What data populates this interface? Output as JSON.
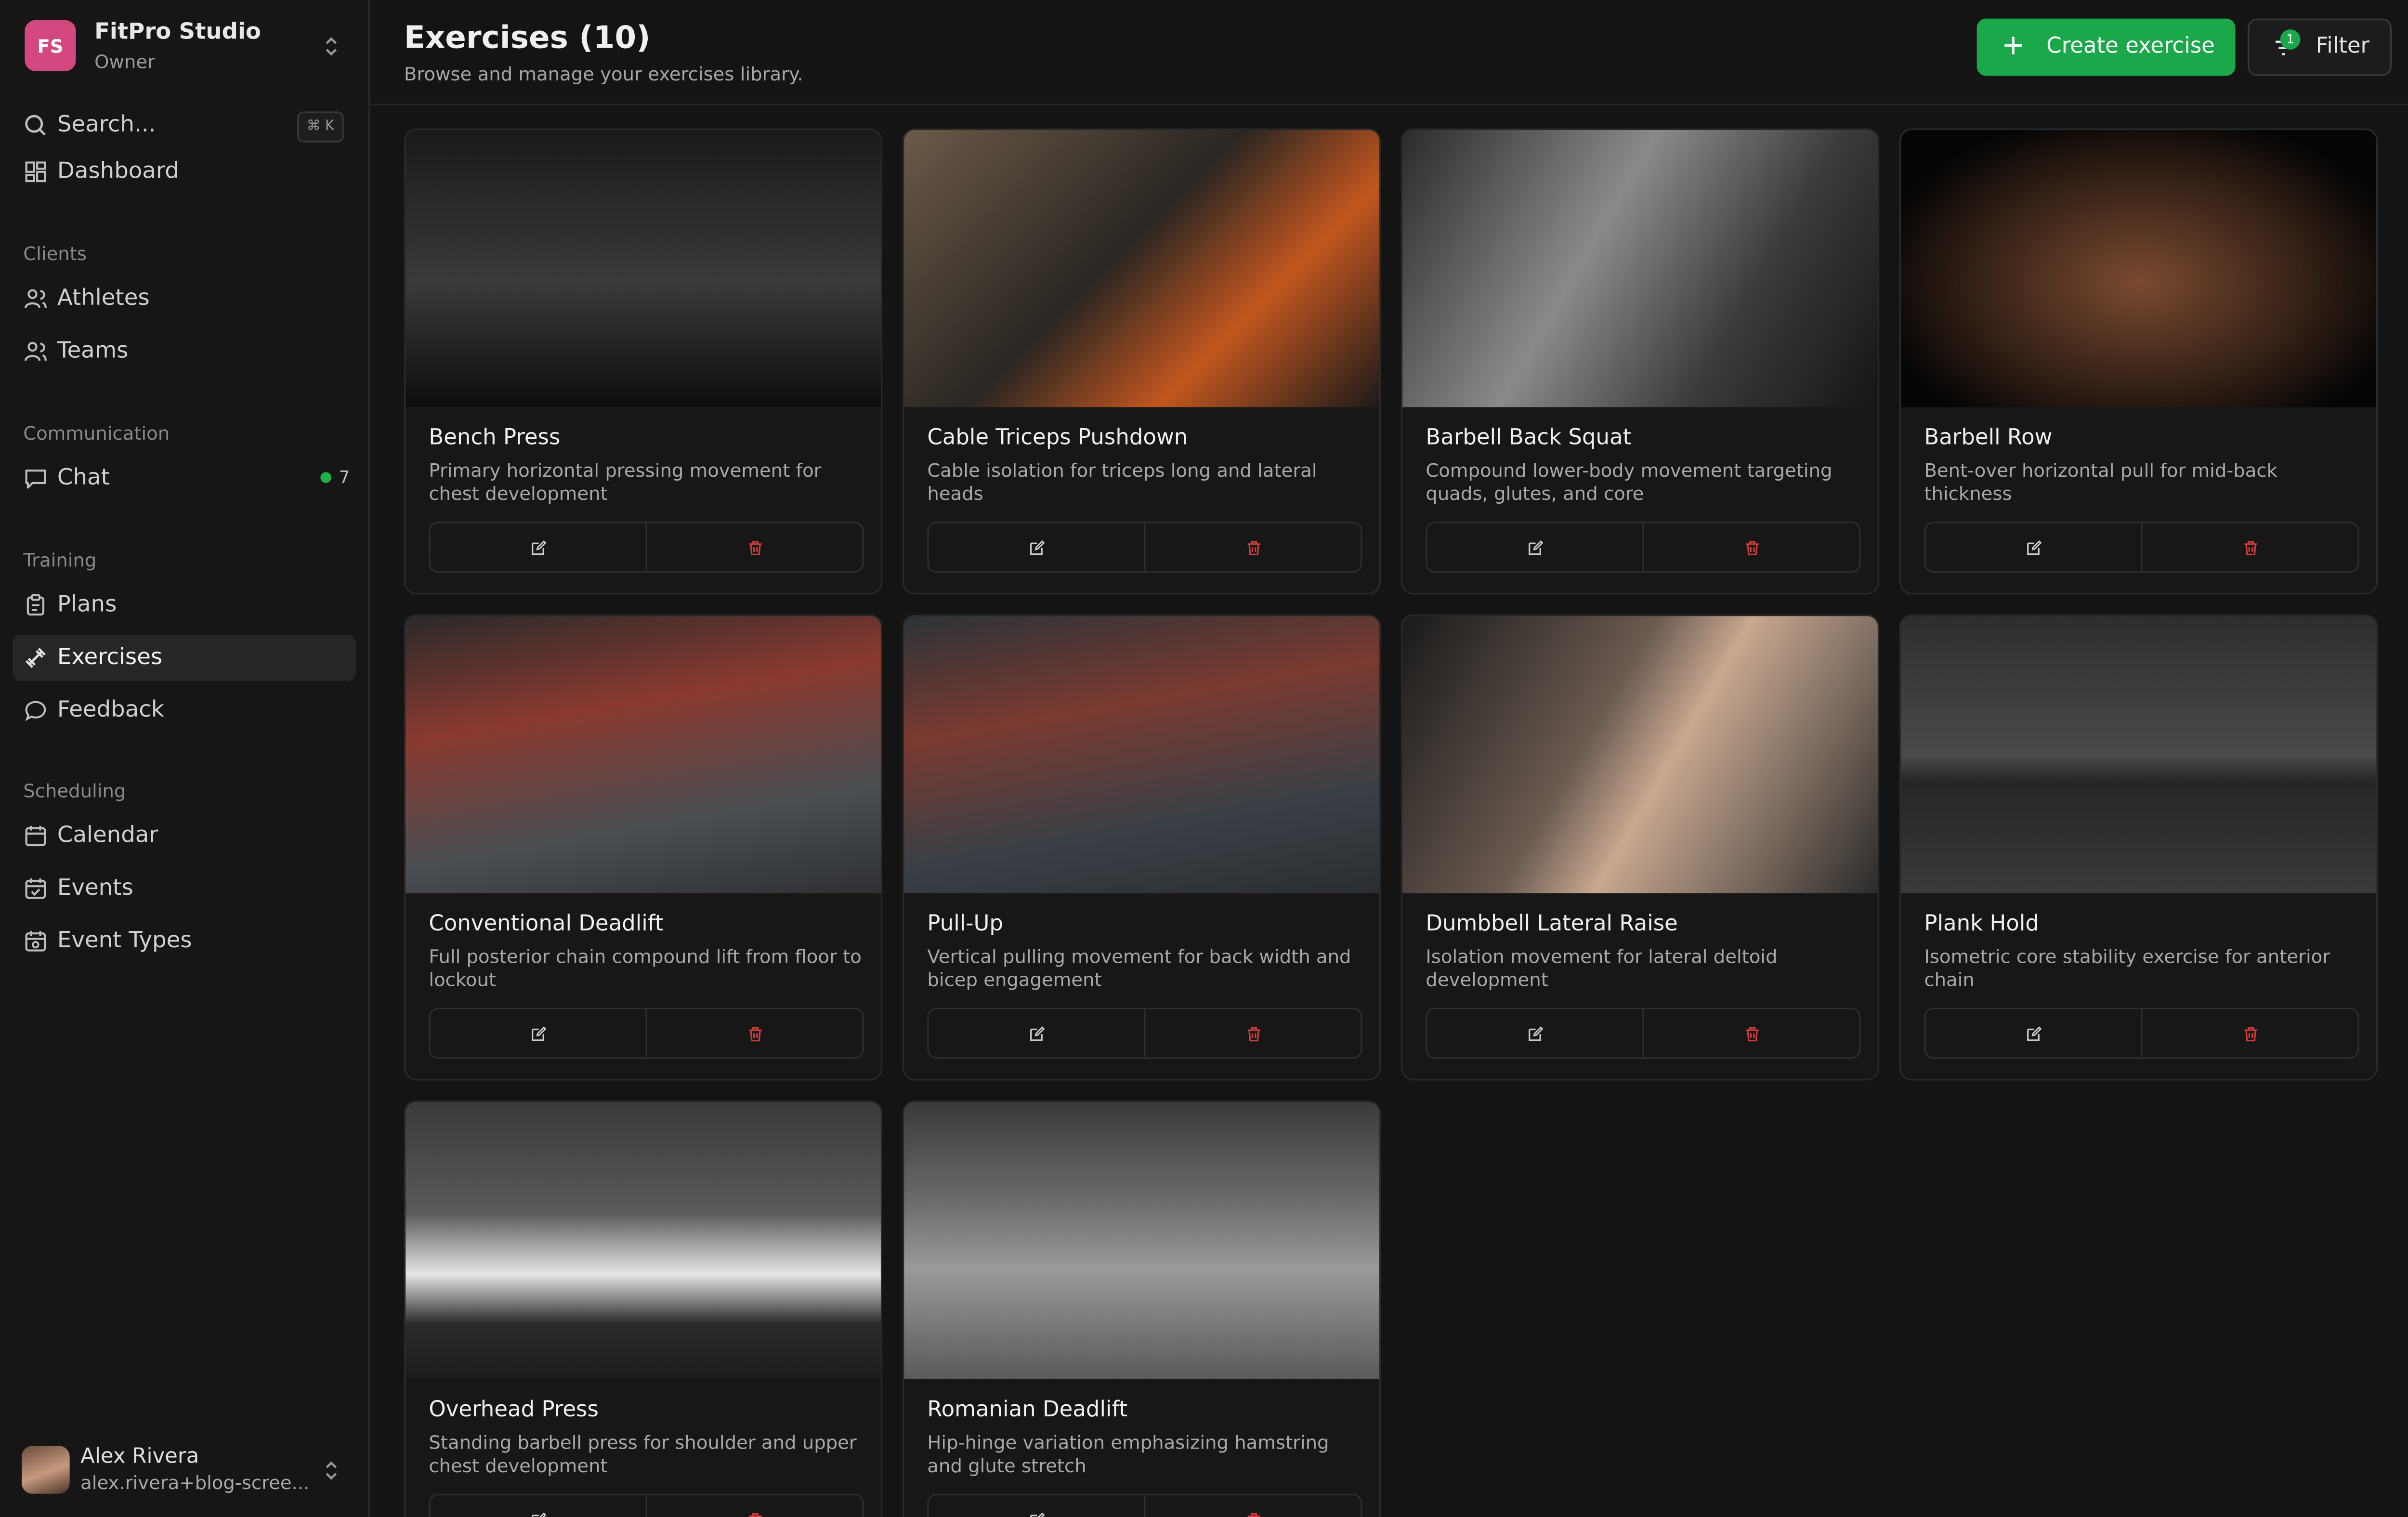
{
  "org": {
    "initials": "FS",
    "name": "FitPro Studio",
    "role": "Owner"
  },
  "search": {
    "label": "Search...",
    "shortcut": "⌘ K"
  },
  "nav": {
    "dashboard": "Dashboard",
    "clients_section": "Clients",
    "athletes": "Athletes",
    "teams": "Teams",
    "communication_section": "Communication",
    "chat": "Chat",
    "chat_count": "7",
    "training_section": "Training",
    "plans": "Plans",
    "exercises": "Exercises",
    "feedback": "Feedback",
    "scheduling_section": "Scheduling",
    "calendar": "Calendar",
    "events": "Events",
    "event_types": "Event Types"
  },
  "user": {
    "name": "Alex Rivera",
    "email": "alex.rivera+blog-scree..."
  },
  "header": {
    "title": "Exercises (10)",
    "subtitle": "Browse and manage your exercises library.",
    "create_label": "Create exercise",
    "filter_label": "Filter",
    "filter_count": "1"
  },
  "exercises": [
    {
      "name": "Bench Press",
      "description": "Primary horizontal pressing movement for chest development"
    },
    {
      "name": "Cable Triceps Pushdown",
      "description": "Cable isolation for triceps long and lateral heads"
    },
    {
      "name": "Barbell Back Squat",
      "description": "Compound lower-body movement targeting quads, glutes, and core"
    },
    {
      "name": "Barbell Row",
      "description": "Bent-over horizontal pull for mid-back thickness"
    },
    {
      "name": "Conventional Deadlift",
      "description": "Full posterior chain compound lift from floor to lockout"
    },
    {
      "name": "Pull-Up",
      "description": "Vertical pulling movement for back width and bicep engagement"
    },
    {
      "name": "Dumbbell Lateral Raise",
      "description": "Isolation movement for lateral deltoid development"
    },
    {
      "name": "Plank Hold",
      "description": "Isometric core stability exercise for anterior chain"
    },
    {
      "name": "Overhead Press",
      "description": "Standing barbell press for shoulder and upper chest development"
    },
    {
      "name": "Romanian Deadlift",
      "description": "Hip-hinge variation emphasizing hamstring and glute stretch"
    }
  ],
  "colors": {
    "accent": "#1aa84a",
    "danger": "#d23b3b",
    "org_avatar": "#d2487f",
    "background": "#141414"
  }
}
